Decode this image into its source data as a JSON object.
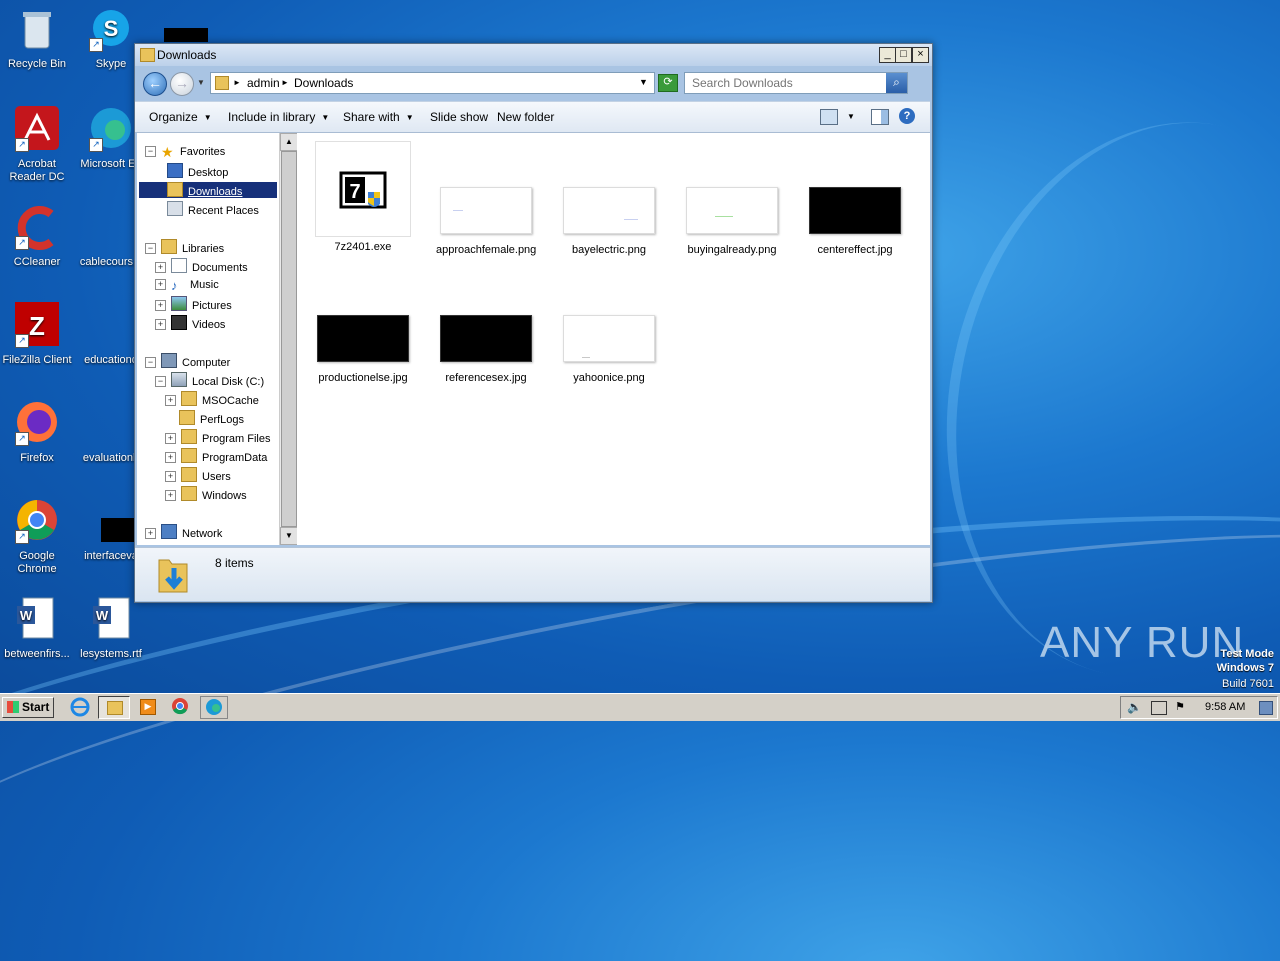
{
  "desktop": {
    "icons": [
      {
        "label": "Recycle Bin"
      },
      {
        "label": "Skype"
      },
      {
        "label": "Acrobat Reader DC"
      },
      {
        "label": "Microsoft Ed"
      },
      {
        "label": "CCleaner"
      },
      {
        "label": "cablecours..."
      },
      {
        "label": "FileZilla Client"
      },
      {
        "label": "educationd"
      },
      {
        "label": "Firefox"
      },
      {
        "label": "evaluationh"
      },
      {
        "label": "Google Chrome"
      },
      {
        "label": "interfaceva"
      },
      {
        "label": "betweenfirs..."
      },
      {
        "label": "lesystems.rtf"
      }
    ],
    "watermark": "ANY RUN",
    "test_mode": [
      "Test Mode",
      "Windows 7",
      "Build 7601"
    ]
  },
  "window": {
    "title": "Downloads",
    "controls": {
      "minimize": "_",
      "maximize": "□",
      "close": "×"
    },
    "address": {
      "segments": [
        "admin",
        "Downloads"
      ],
      "separator": "►"
    },
    "search": {
      "placeholder": "Search Downloads"
    },
    "toolbar": {
      "organize": "Organize",
      "include": "Include in library",
      "share": "Share with",
      "slideshow": "Slide show",
      "newfolder": "New folder"
    },
    "nav": {
      "favorites": "Favorites",
      "desktop": "Desktop",
      "downloads": "Downloads",
      "recent": "Recent Places",
      "libraries": "Libraries",
      "documents": "Documents",
      "music": "Music",
      "pictures": "Pictures",
      "videos": "Videos",
      "computer": "Computer",
      "localdisk": "Local Disk (C:)",
      "msocache": "MSOCache",
      "perflogs": "PerfLogs",
      "programfiles": "Program Files",
      "programdata": "ProgramData",
      "users": "Users",
      "windows": "Windows",
      "network": "Network"
    },
    "files": [
      {
        "name": "7z2401.exe",
        "kind": "exe"
      },
      {
        "name": "approachfemale.png",
        "kind": "white"
      },
      {
        "name": "bayelectric.png",
        "kind": "white"
      },
      {
        "name": "buyingalready.png",
        "kind": "white"
      },
      {
        "name": "centereffect.jpg",
        "kind": "black"
      },
      {
        "name": "productionelse.jpg",
        "kind": "black"
      },
      {
        "name": "referencesex.jpg",
        "kind": "black"
      },
      {
        "name": "yahoonice.png",
        "kind": "white"
      }
    ],
    "status": {
      "count": "8 items"
    }
  },
  "taskbar": {
    "start": "Start",
    "time": "9:58 AM"
  },
  "colors": {
    "selection": "#16307a",
    "desktop": "#1c78cf"
  }
}
